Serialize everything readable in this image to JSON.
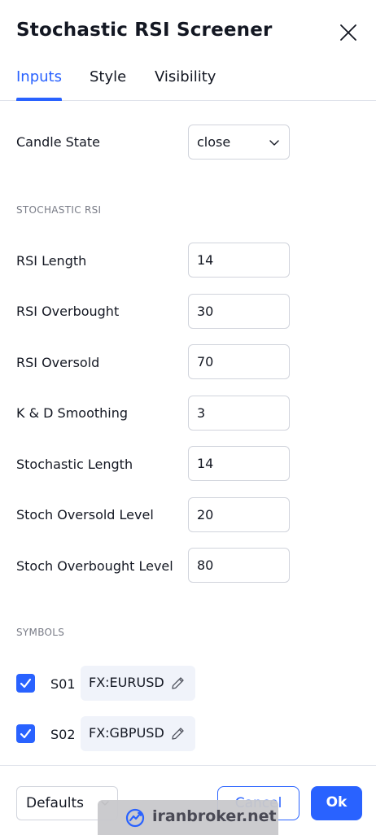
{
  "dialog": {
    "title": "Stochastic RSI Screener",
    "close_icon": "close-icon",
    "tabs": [
      {
        "label": "Inputs",
        "active": true
      },
      {
        "label": "Style",
        "active": false
      },
      {
        "label": "Visibility",
        "active": false
      }
    ]
  },
  "inputs": {
    "candle_state": {
      "label": "Candle State",
      "value": "close"
    },
    "section_stoch": "STOCHASTIC RSI",
    "rsi_length": {
      "label": "RSI Length",
      "value": "14"
    },
    "rsi_overbought": {
      "label": "RSI Overbought",
      "value": "30"
    },
    "rsi_oversold": {
      "label": "RSI Oversold",
      "value": "70"
    },
    "kd_smoothing": {
      "label": "K & D Smoothing",
      "value": "3"
    },
    "stoch_length": {
      "label": "Stochastic Length",
      "value": "14"
    },
    "stoch_oversold": {
      "label": "Stoch Oversold Level",
      "value": "20"
    },
    "stoch_overbought": {
      "label": "Stoch Overbought Level",
      "value": "80"
    },
    "section_symbols": "SYMBOLS",
    "symbols": [
      {
        "id": "S01",
        "symbol": "FX:EURUSD",
        "checked": true
      },
      {
        "id": "S02",
        "symbol": "FX:GBPUSD",
        "checked": true
      }
    ]
  },
  "footer": {
    "defaults_label": "Defaults",
    "cancel_label": "Cancel",
    "ok_label": "Ok"
  },
  "watermark": {
    "text": "iranbroker.net"
  },
  "colors": {
    "accent": "#2962ff",
    "text": "#131722",
    "muted": "#787b86",
    "border": "#d1d4dc"
  }
}
